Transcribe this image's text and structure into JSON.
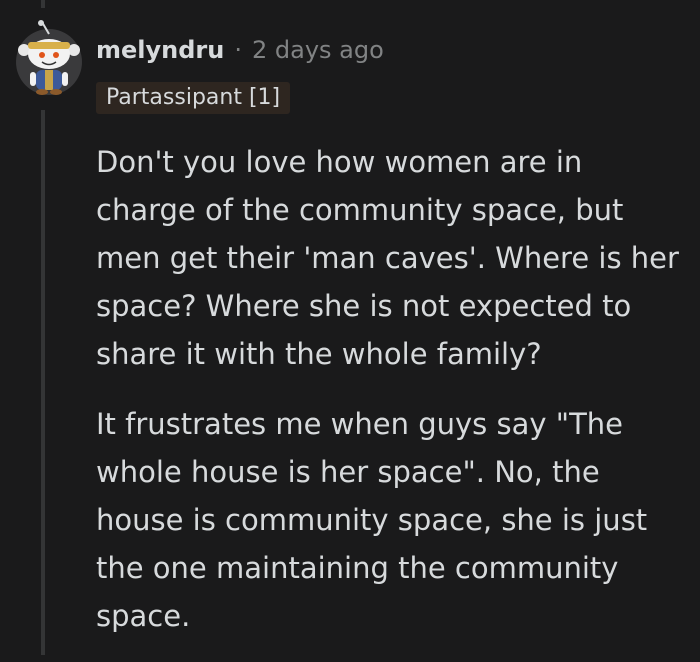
{
  "comment": {
    "author": "melyndru",
    "separator": "·",
    "time": "2 days ago",
    "flair": "Partassipant [1]",
    "paragraphs": [
      "Don't you love how women are in charge of the community space, but men get their 'man caves'. Where is her space? Where she is not expected to share it with the whole family?",
      "It frustrates me when guys say \"The whole house is her space\". No, the house is community space, she is just the one maintaining the community space."
    ]
  },
  "colors": {
    "background": "#1a1a1b",
    "text": "#d7dadc",
    "meta": "#818384",
    "flair_background": "#2e2620",
    "thread_line": "#343536"
  },
  "icons": {
    "avatar": "snoo-avatar-icon"
  }
}
